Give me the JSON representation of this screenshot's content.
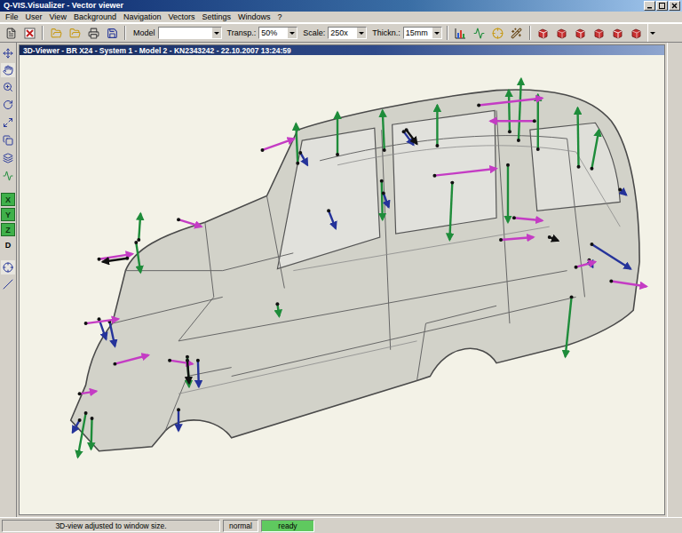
{
  "window": {
    "title": "Q-VIS.Visualizer - Vector viewer"
  },
  "menu": [
    "File",
    "User",
    "View",
    "Background",
    "Navigation",
    "Vectors",
    "Settings",
    "Windows",
    "?"
  ],
  "toolbar": {
    "fields": [
      {
        "label": "Model",
        "value": ""
      },
      {
        "label": "Transp.:",
        "value": "50%"
      },
      {
        "label": "Scale:",
        "value": "250x"
      },
      {
        "label": "Thickn.:",
        "value": "15mm"
      }
    ]
  },
  "side_tools": [
    {
      "selected": false
    },
    {
      "selected": true
    },
    {
      "selected": false
    },
    {
      "selected": false
    },
    {
      "selected": false
    },
    {
      "selected": false
    },
    {
      "selected": false
    },
    {
      "selected": false
    }
  ],
  "axis_buttons": [
    {
      "label": "X",
      "selected": true
    },
    {
      "label": "Y",
      "selected": true
    },
    {
      "label": "Z",
      "selected": true
    },
    {
      "label": "D",
      "selected": false
    }
  ],
  "side_tools_lower": [
    {
      "selected": true
    },
    {
      "selected": false
    }
  ],
  "viewer": {
    "title": "3D-Viewer - BR X24 - System 1 - Model 2 - KN2343242 - 22.10.2007 13:24:59"
  },
  "status_bar": {
    "message": "3D-view adjusted to window size.",
    "mode": "normal",
    "state": "ready"
  }
}
